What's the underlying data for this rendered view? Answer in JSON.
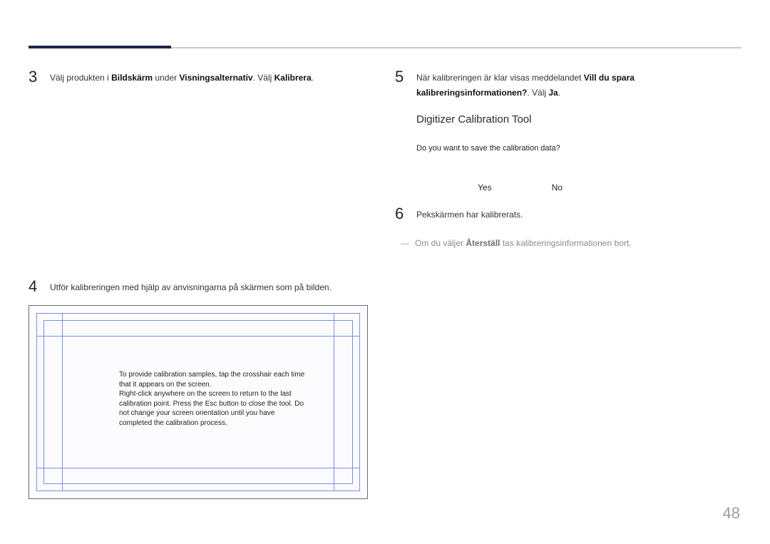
{
  "page_number": "48",
  "left": {
    "step3": {
      "num": "3",
      "pre": "Välj produkten i ",
      "b1": "Bildskärm",
      "mid1": " under ",
      "b2": "Visningsalternativ",
      "mid2": ". Välj ",
      "b3": "Kalibrera",
      "post": "."
    },
    "step4": {
      "num": "4",
      "text": "Utför kalibreringen med hjälp av anvisningarna på skärmen som på bilden."
    },
    "calib_center": "To provide calibration samples, tap the crosshair each time that it appears on the screen.\nRight-click anywhere on the screen to return to the last calibration point. Press the Esc button to close the tool. Do not change your screen orientation until you have completed the calibration process."
  },
  "right": {
    "step5": {
      "num": "5",
      "pre": "När kalibreringen är klar visas meddelandet ",
      "b1": "Vill du spara kalibreringsinformationen?",
      "mid1": ". Välj ",
      "b2": "Ja",
      "post": "."
    },
    "dialog": {
      "title": "Digitizer Calibration Tool",
      "message": "Do you want to save the calibration data?",
      "yes": "Yes",
      "no": "No"
    },
    "step6": {
      "num": "6",
      "text": "Pekskärmen har kalibrerats."
    },
    "note": {
      "dash": "―",
      "pre": "Om du väljer ",
      "b1": "Återställ",
      "post": " tas kalibreringsinformationen bort."
    }
  }
}
